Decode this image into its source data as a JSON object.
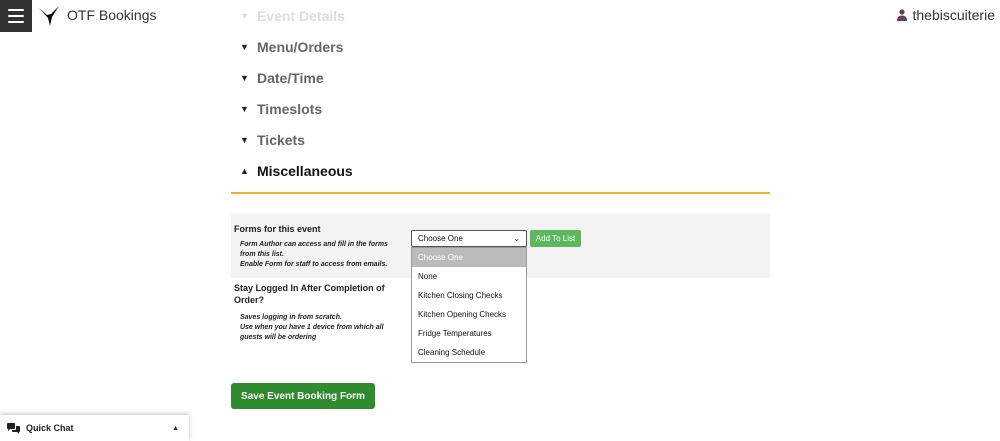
{
  "header": {
    "app_title": "OTF Bookings",
    "username": "thebiscuiterie"
  },
  "sections": [
    {
      "label": "Event Details",
      "caret": "▼"
    },
    {
      "label": "Menu/Orders",
      "caret": "▼"
    },
    {
      "label": "Date/Time",
      "caret": "▼"
    },
    {
      "label": "Timeslots",
      "caret": "▼"
    },
    {
      "label": "Tickets",
      "caret": "▼"
    },
    {
      "label": "Miscellaneous",
      "caret": "▲"
    }
  ],
  "forms_field": {
    "title": "Forms for this event",
    "description_line1": "Form Author can access and fill in the forms",
    "description_line2": "from this list.",
    "description_line3": "Enable Form for staff to access from emails.",
    "select_value": "Choose One",
    "add_button": "Add To List",
    "options": [
      "Choose One",
      "None",
      "Kitchen Closing Checks",
      "Kitchen Opening Checks",
      "Fridge Temperatures",
      "Cleaning Schedule"
    ]
  },
  "stay_logged_field": {
    "title_line1": "Stay Logged In After Completion of",
    "title_line2": "Order?",
    "description_line1": "Saves logging in from scratch.",
    "description_line2": "Use when you have 1 device from which all",
    "description_line3": "guests will be ordering"
  },
  "save_button": "Save Event Booking Form",
  "quick_chat": {
    "label": "Quick Chat",
    "caret": "▲"
  },
  "colors": {
    "divider": "#e6b52c",
    "add_button": "#5cb85c",
    "save_button": "#2e8b2e",
    "user_icon": "#6b3d5c"
  }
}
